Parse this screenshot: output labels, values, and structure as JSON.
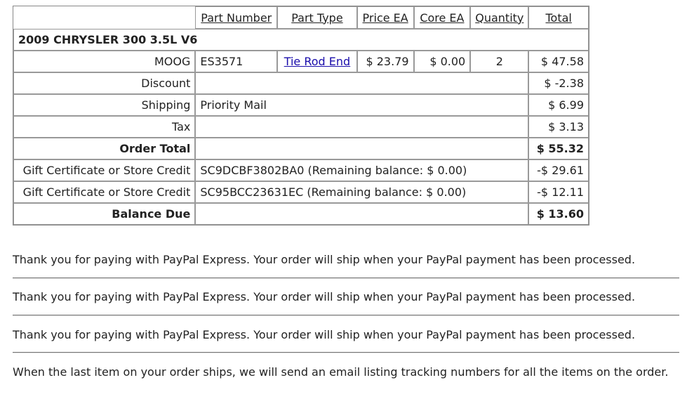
{
  "headers": {
    "part_number": "Part Number",
    "part_type": "Part Type",
    "price_ea": "Price EA",
    "core_ea": "Core EA",
    "quantity": "Quantity",
    "total": "Total"
  },
  "vehicle": "2009 CHRYSLER 300 3.5L V6",
  "item": {
    "brand": "MOOG",
    "part_number": "ES3571",
    "part_type": "Tie Rod End",
    "price_ea": "$ 23.79",
    "core_ea": "$ 0.00",
    "quantity": "2",
    "total": "$ 47.58"
  },
  "discount": {
    "label": "Discount",
    "amount": "$ -2.38"
  },
  "shipping": {
    "label": "Shipping",
    "method": "Priority Mail",
    "amount": "$ 6.99"
  },
  "tax": {
    "label": "Tax",
    "amount": "$ 3.13"
  },
  "order_total": {
    "label": "Order Total",
    "amount": "$ 55.32"
  },
  "credits": [
    {
      "label": "Gift Certificate or Store Credit",
      "detail": "SC9DCBF3802BA0 (Remaining balance: $ 0.00)",
      "amount": "-$ 29.61"
    },
    {
      "label": "Gift Certificate or Store Credit",
      "detail": "SC95BCC23631EC (Remaining balance: $ 0.00)",
      "amount": "-$ 12.11"
    }
  ],
  "balance_due": {
    "label": "Balance Due",
    "amount": "$ 13.60"
  },
  "messages": [
    "Thank you for paying with PayPal Express. Your order will ship when your PayPal payment has been processed.",
    "Thank you for paying with PayPal Express. Your order will ship when your PayPal payment has been processed.",
    "Thank you for paying with PayPal Express. Your order will ship when your PayPal payment has been processed.",
    "When the last item on your order ships, we will send an email listing tracking numbers for all the items on the order."
  ]
}
